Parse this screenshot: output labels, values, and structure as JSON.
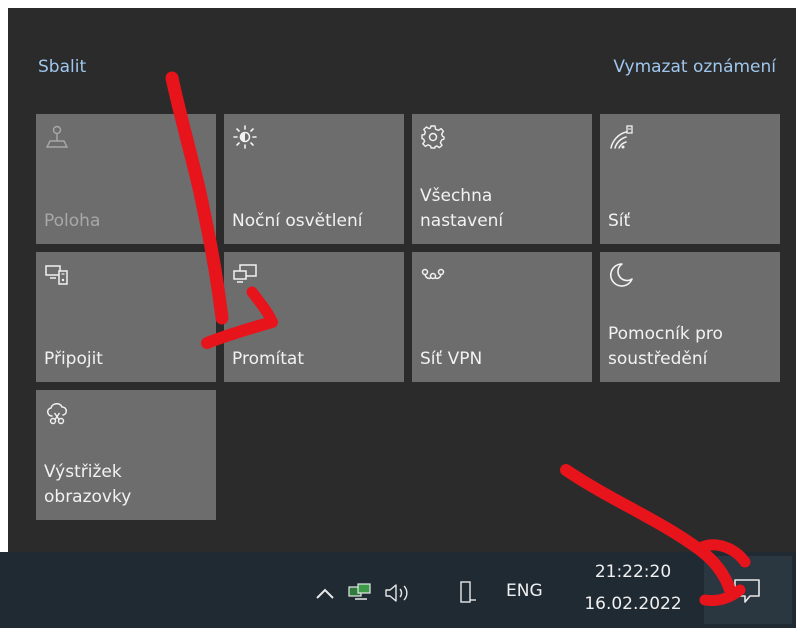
{
  "header": {
    "collapse_label": "Sbalit",
    "clear_label": "Vymazat oznámení"
  },
  "tiles": [
    {
      "label": "Poloha",
      "icon": "location-icon",
      "state": "disabled"
    },
    {
      "label": "Noční osvětlení",
      "icon": "brightness-icon",
      "state": "off"
    },
    {
      "label": "Všechna\nnastavení",
      "icon": "gear-icon",
      "state": "off"
    },
    {
      "label": "Síť",
      "icon": "network-icon",
      "state": "off"
    },
    {
      "label": "Připojit",
      "icon": "connect-icon",
      "state": "off"
    },
    {
      "label": "Promítat",
      "icon": "project-icon",
      "state": "off"
    },
    {
      "label": "Síť VPN",
      "icon": "vpn-icon",
      "state": "off"
    },
    {
      "label": "Pomocník pro\nsoustředění",
      "icon": "moon-icon",
      "state": "off"
    },
    {
      "label": "Výstřižek\nobrazovky",
      "icon": "snip-icon",
      "state": "off"
    }
  ],
  "taskbar": {
    "language": "ENG",
    "time": "21:22:20",
    "date": "16.02.2022"
  },
  "colors": {
    "panel_bg": "#2b2b2b",
    "tile_bg": "#6d6d6d",
    "link": "#9fc6ee",
    "taskbar_bg": "#1f2a33",
    "annotation": "#e8141b"
  }
}
